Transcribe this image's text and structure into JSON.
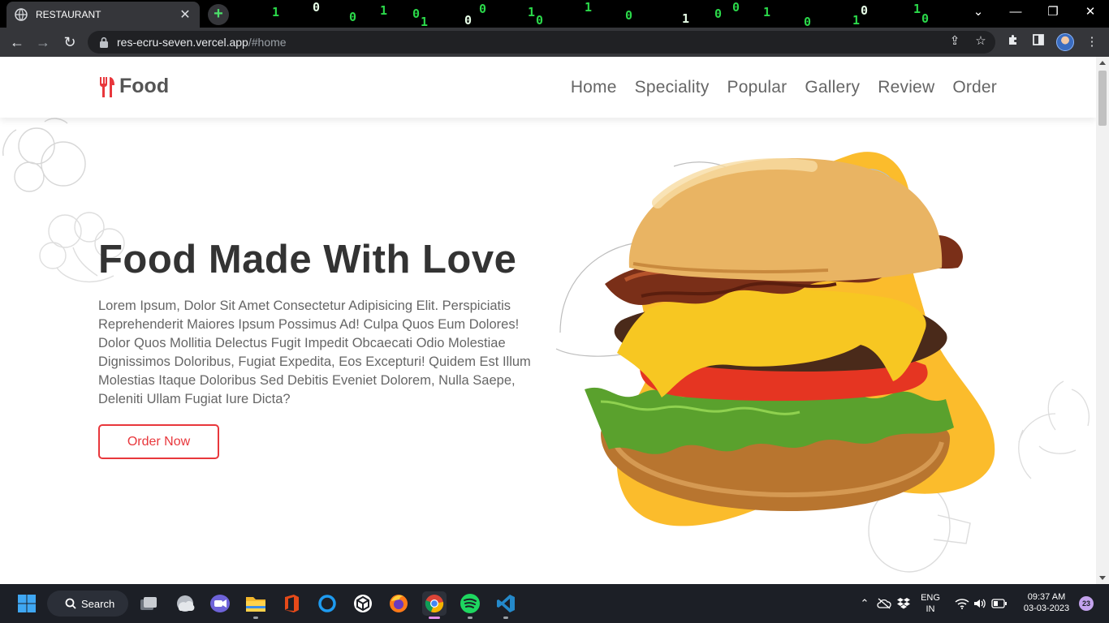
{
  "browser": {
    "tab_title": "RESTAURANT",
    "tab_close": "✕",
    "new_tab": "+",
    "url_host": "res-ecru-seven.vercel.app",
    "url_path": "/#home",
    "matrix_glyphs": [
      "1",
      "0",
      "0",
      "1",
      "0",
      "1",
      "0",
      "0",
      "1",
      "1",
      "0",
      "1",
      "0",
      "0",
      "1",
      "0",
      "0",
      "1",
      "0",
      "1",
      "0"
    ]
  },
  "site": {
    "logo_text": "Food",
    "nav": [
      "Home",
      "Speciality",
      "Popular",
      "Gallery",
      "Review",
      "Order"
    ],
    "hero": {
      "title": "Food Made With Love",
      "text": "Lorem Ipsum, Dolor Sit Amet Consectetur Adipisicing Elit. Perspiciatis Reprehenderit Maiores Ipsum Possimus Ad! Culpa Quos Eum Dolores! Dolor Quos Mollitia Delectus Fugit Impedit Obcaecati Odio Molestiae Dignissimos Doloribus, Fugiat Expedita, Eos Excepturi! Quidem Est Illum Molestias Itaque Doloribus Sed Debitis Eveniet Dolorem, Nulla Saepe, Deleniti Ullam Fugiat Iure Dicta?",
      "button": "Order Now"
    },
    "colors": {
      "accent": "#e8373c",
      "blob": "#fbbc2c"
    }
  },
  "taskbar": {
    "search_label": "Search",
    "lang_top": "ENG",
    "lang_bottom": "IN",
    "time": "09:37 AM",
    "date": "03-03-2023",
    "notifications": "23",
    "apps": [
      "windows-start-icon",
      "task-view-icon",
      "weather-icon",
      "meet-icon",
      "file-explorer-icon",
      "office-icon",
      "cortana-icon",
      "unity-icon",
      "firefox-icon",
      "chrome-icon",
      "spotify-icon",
      "vscode-icon"
    ]
  }
}
